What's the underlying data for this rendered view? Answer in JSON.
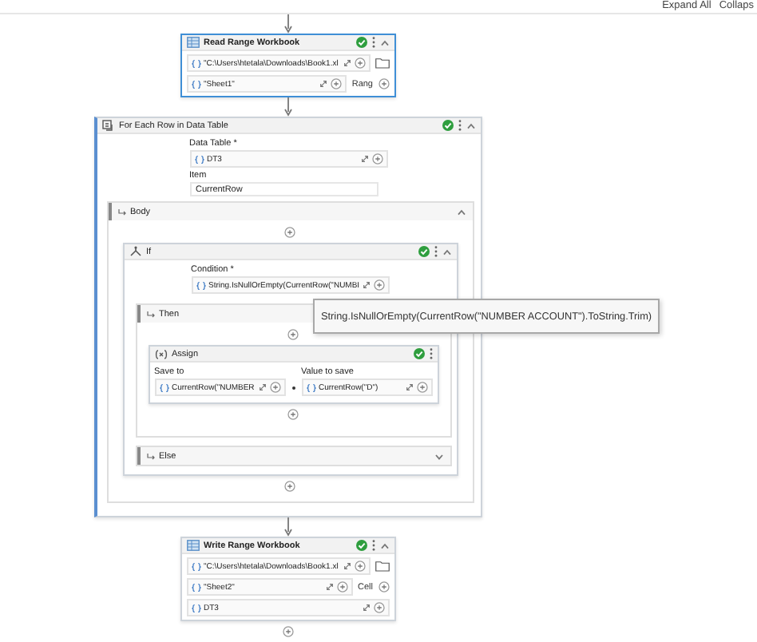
{
  "toolbar": {
    "buttons": [
      {
        "label": "Expand All"
      },
      {
        "label": "Collaps"
      }
    ]
  },
  "read_range": {
    "title": "Read Range Workbook",
    "valid": true,
    "selected": true,
    "fields": [
      {
        "value": "\"C:\\Users\\htetala\\Downloads\\Book1.xl",
        "kind": "file"
      },
      {
        "value": "\"Sheet1\"",
        "kind": "option",
        "option": "Rang"
      }
    ]
  },
  "for_each": {
    "title": "For Each Row in Data Table",
    "valid": true,
    "data_table": {
      "label": "Data Table *",
      "value": "DT3"
    },
    "item": {
      "label": "Item",
      "value": "CurrentRow"
    },
    "body": {
      "title": "Body",
      "expanded": true,
      "if": {
        "title": "If",
        "valid": true,
        "condition": {
          "label": "Condition *",
          "value": "String.IsNullOrEmpty(CurrentRow(\"NUMBI"
        },
        "then": {
          "title": "Then",
          "expanded": true,
          "assign": {
            "title": "Assign",
            "valid": true,
            "save_to": {
              "label": "Save to",
              "value": "CurrentRow(\"NUMBER"
            },
            "value_to_save": {
              "label": "Value to save",
              "value": "CurrentRow(\"D\")"
            }
          }
        },
        "else": {
          "title": "Else",
          "expanded": false
        }
      }
    }
  },
  "tooltip": {
    "text": "String.IsNullOrEmpty(CurrentRow(\"NUMBER ACCOUNT\").ToString.Trim)"
  },
  "write_range": {
    "title": "Write Range Workbook",
    "valid": true,
    "selected": false,
    "fields": [
      {
        "value": "\"C:\\Users\\htetala\\Downloads\\Book1.xl",
        "kind": "file"
      },
      {
        "value": "\"Sheet2\"",
        "kind": "option",
        "option": "Cell"
      },
      {
        "value": "DT3",
        "kind": "plain"
      }
    ]
  }
}
